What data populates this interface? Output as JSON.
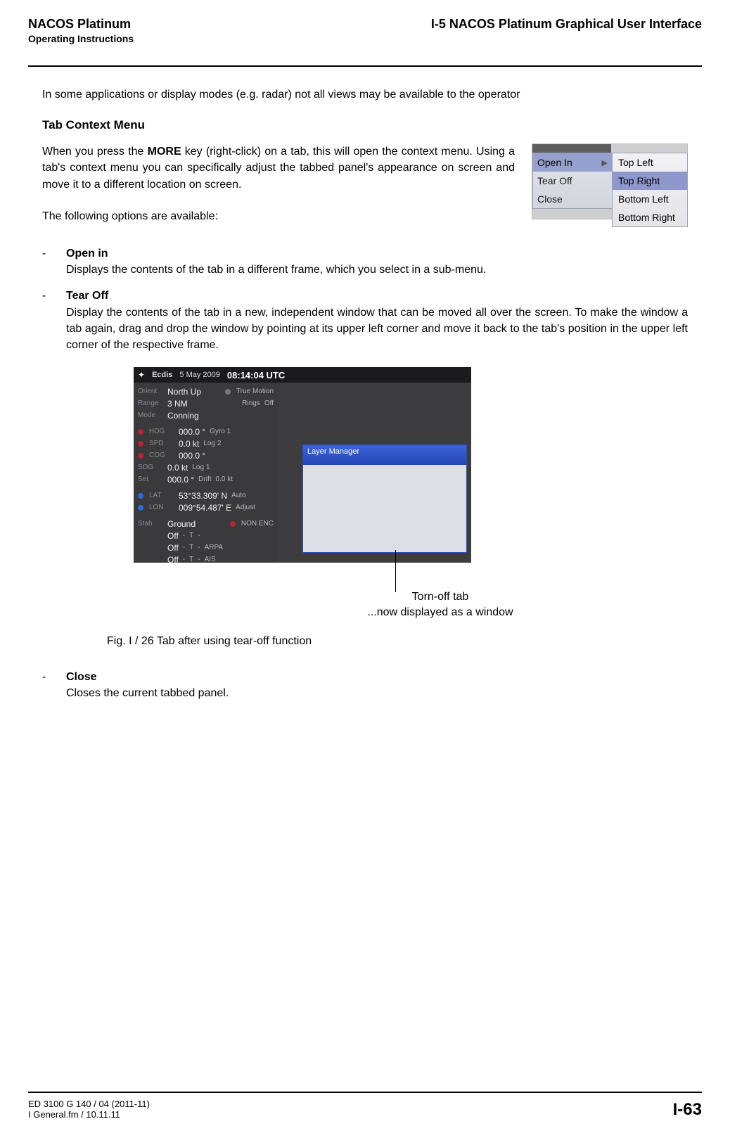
{
  "header": {
    "left_title": "NACOS Platinum",
    "left_sub": "Operating Instructions",
    "right": "I-5  NACOS Platinum Graphical User Interface"
  },
  "intro": "In some applications or display modes (e.g. radar) not all views may be available to the operator",
  "section_title": "Tab Context Menu",
  "para1_a": "When you press the ",
  "para1_bold": "MORE",
  "para1_b": " key (right-click) on a tab, this will open the context menu. Using a tab's context menu you can specifically adjust the tabbed panel's appearance on screen and move it to a different location on screen.",
  "para2": "The following options are available:",
  "context_menu": {
    "left": [
      "Open In",
      "Tear Off",
      "Close"
    ],
    "right": [
      "Top Left",
      "Top Right",
      "Bottom Left",
      "Bottom Right"
    ]
  },
  "options": [
    {
      "title": "Open in",
      "desc": "Displays the contents of the tab in a different frame, which you select in a sub-menu."
    },
    {
      "title": "Tear Off",
      "desc": "Display the contents of the tab in a new, independent window that can be moved all over the screen. To make the window a tab again, drag and drop the window by pointing at its upper left corner and move it back to the tab's position in the upper left corner of the respective frame."
    }
  ],
  "options2": [
    {
      "title": "Close",
      "desc": "Closes the current tabbed panel."
    }
  ],
  "ecdis": {
    "name": "Ecdis",
    "date": "5 May 2009",
    "time": "08:14:04 UTC",
    "orient": "North Up",
    "motion_lbl": "True Motion",
    "range": "3 NM",
    "rings": "Off",
    "mode": "Conning",
    "hdg": "000.0 °",
    "hdg_src": "Gyro 1",
    "spd1": "0.0 kt",
    "spd1_src": "Log 2",
    "cog": "000.0 °",
    "sog": "0.0 kt",
    "sog_src": "Log 1",
    "set": "000.0 °",
    "drift": "0.0 kt",
    "lat": "53°33.309' N",
    "lat_src": "Auto",
    "lon": "009°54.487' E",
    "lon_src": "Adjust",
    "stab": "Ground",
    "nonenc": "NON ENC",
    "off": "Off",
    "t": "T",
    "arpa": "ARPA",
    "ais": "AIS",
    "win_title": "Layer Manager"
  },
  "callout": {
    "l1": "Torn-off tab",
    "l2": "...now displayed as a window"
  },
  "fig_caption": "Fig. I /  26    Tab after using tear-off function",
  "footer": {
    "doc": "ED 3100 G 140 / 04 (2011-11)",
    "file": "I General.fm / 10.11.11",
    "page": "I-63"
  }
}
